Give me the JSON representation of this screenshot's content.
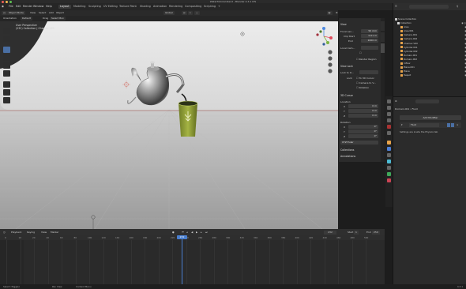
{
  "window": {
    "title": "WaterTutorial.blend - Blender 4.3.1 LTS"
  },
  "topbar": {
    "menus": [
      "File",
      "Edit",
      "Render",
      "Window",
      "Help"
    ],
    "workspaces": [
      "Layout",
      "Modeling",
      "Sculpting",
      "UV Editing",
      "Texture Paint",
      "Shading",
      "Animation",
      "Rendering",
      "Compositing",
      "Scripting"
    ],
    "active_workspace": "Layout",
    "scene": "Scene",
    "view_layer": "View Layer"
  },
  "viewport_header": {
    "mode": "Object Mode",
    "menus": [
      "View",
      "Select",
      "Add",
      "Object"
    ],
    "orientation": "Global",
    "orientation_label": "Orientation",
    "drag_label": "Drag",
    "drag_value": "Select Box",
    "transform_default": "Default"
  },
  "viewport_overlay": {
    "line1": "User Perspective",
    "line2": "(232) Collection | Chemex V60"
  },
  "npanel": {
    "tabs": [
      "Item",
      "Tool",
      "View"
    ],
    "view_section": "View",
    "focal_length_label": "Focal Len...",
    "focal_length": "50 mm",
    "clip_start_label": "Clip Start",
    "clip_start": "0.01 m",
    "clip_end_label": "End",
    "clip_end": "1000 m",
    "local_camera_label": "Local Cam...",
    "render_region_label": "Render Region",
    "view_lock_section": "View Lock",
    "lock_to_object_label": "Lock to O...",
    "lock_label": "Lock",
    "to_3d_cursor": "To 3D Cursor",
    "camera_to_view": "Camera to V...",
    "rotation_lock": "Rotation",
    "cursor_section": "3D Cursor",
    "location_label": "Location",
    "loc": [
      "0 m",
      "0 m",
      "0 m"
    ],
    "rotation_label": "Rotation",
    "rot": [
      "0°",
      "0°",
      "0°"
    ],
    "xyz_label": "XYZ Euler",
    "axes": [
      "X",
      "Y",
      "Z"
    ],
    "collections_section": "Collections",
    "annotations_section": "Annotations"
  },
  "outliner": {
    "header": "Scene Collection",
    "rows": [
      {
        "name": "Collection",
        "color": "#d9d9d9"
      },
      {
        "name": "Area",
        "color": "#e7a34a"
      },
      {
        "name": "Area.001",
        "color": "#e7a34a"
      },
      {
        "name": "Camera.001",
        "color": "#e7a34a"
      },
      {
        "name": "Camera.002",
        "color": "#e7a34a"
      },
      {
        "name": "Chemex V60",
        "color": "#e7a34a"
      },
      {
        "name": "Cylinder.001",
        "color": "#e7a34a"
      },
      {
        "name": "Cylinder.002",
        "color": "#e7a34a"
      },
      {
        "name": "Domain.001",
        "color": "#e7a34a"
      },
      {
        "name": "Domain.002",
        "color": "#e7a34a"
      },
      {
        "name": "Inflow",
        "color": "#e7a34a"
      },
      {
        "name": "Plane.001",
        "color": "#e7a34a"
      },
      {
        "name": "Plane",
        "color": "#e7a34a"
      },
      {
        "name": "Teapot",
        "color": "#e7a34a"
      }
    ]
  },
  "properties": {
    "search_placeholder": "",
    "breadcrumb_obj": "Domain.001",
    "breadcrumb_mod": "Fluid",
    "add_modifier": "Add Modifier",
    "modifier_name": "Fluid",
    "note": "Settings are inside the Physics tab"
  },
  "timeline": {
    "menus": [
      "Playback",
      "Keying",
      "View",
      "Marker"
    ],
    "current_frame": "232",
    "start_label": "Start",
    "start": "1",
    "end_label": "End",
    "end": "250",
    "ticks": [
      "0",
      "10",
      "20",
      "40",
      "60",
      "80",
      "100",
      "120",
      "140",
      "160",
      "180",
      "200",
      "220",
      "240",
      "260",
      "280",
      "300",
      "320",
      "340",
      "360",
      "380",
      "400",
      "420",
      "440",
      "460",
      "480",
      "500"
    ]
  },
  "statusbar": {
    "left": "Select (Toggle)",
    "mid1": "Pan View",
    "mid2": "Context Menu",
    "version": "4.3.1"
  },
  "colors": {
    "accent": "#4a6fa3",
    "active_frame": "#4a7fcf",
    "cup": "#8f9e36"
  }
}
